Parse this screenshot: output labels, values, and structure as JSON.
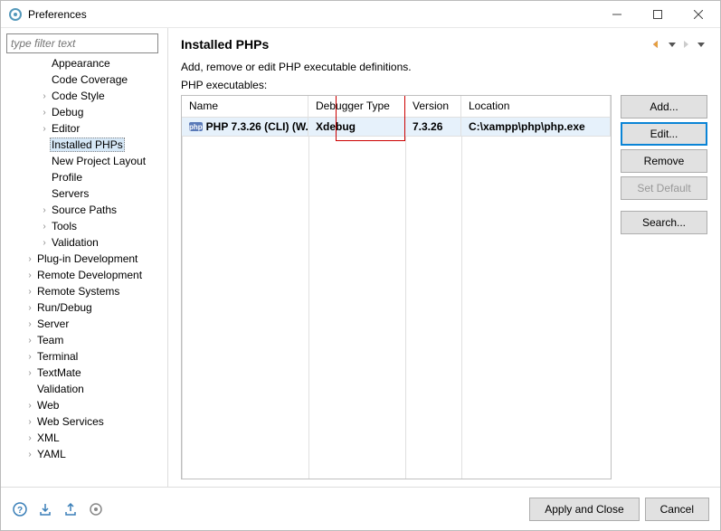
{
  "window": {
    "title": "Preferences"
  },
  "filter_placeholder": "type filter text",
  "tree": [
    {
      "label": "Appearance",
      "depth": 2,
      "arrow": ""
    },
    {
      "label": "Code Coverage",
      "depth": 2,
      "arrow": ""
    },
    {
      "label": "Code Style",
      "depth": 2,
      "arrow": "›"
    },
    {
      "label": "Debug",
      "depth": 2,
      "arrow": "›"
    },
    {
      "label": "Editor",
      "depth": 2,
      "arrow": "›"
    },
    {
      "label": "Installed PHPs",
      "depth": 2,
      "arrow": "",
      "selected": true
    },
    {
      "label": "New Project Layout",
      "depth": 2,
      "arrow": ""
    },
    {
      "label": "Profile",
      "depth": 2,
      "arrow": ""
    },
    {
      "label": "Servers",
      "depth": 2,
      "arrow": ""
    },
    {
      "label": "Source Paths",
      "depth": 2,
      "arrow": "›"
    },
    {
      "label": "Tools",
      "depth": 2,
      "arrow": "›"
    },
    {
      "label": "Validation",
      "depth": 2,
      "arrow": "›"
    },
    {
      "label": "Plug-in Development",
      "depth": 1,
      "arrow": "›"
    },
    {
      "label": "Remote Development",
      "depth": 1,
      "arrow": "›"
    },
    {
      "label": "Remote Systems",
      "depth": 1,
      "arrow": "›"
    },
    {
      "label": "Run/Debug",
      "depth": 1,
      "arrow": "›"
    },
    {
      "label": "Server",
      "depth": 1,
      "arrow": "›"
    },
    {
      "label": "Team",
      "depth": 1,
      "arrow": "›"
    },
    {
      "label": "Terminal",
      "depth": 1,
      "arrow": "›"
    },
    {
      "label": "TextMate",
      "depth": 1,
      "arrow": "›"
    },
    {
      "label": "Validation",
      "depth": 1,
      "arrow": ""
    },
    {
      "label": "Web",
      "depth": 1,
      "arrow": "›"
    },
    {
      "label": "Web Services",
      "depth": 1,
      "arrow": "›"
    },
    {
      "label": "XML",
      "depth": 1,
      "arrow": "›"
    },
    {
      "label": "YAML",
      "depth": 1,
      "arrow": "›"
    }
  ],
  "main": {
    "heading": "Installed PHPs",
    "description": "Add, remove or edit PHP executable definitions.",
    "subdescription": "PHP executables:",
    "columns": {
      "name": "Name",
      "debugger": "Debugger Type",
      "version": "Version",
      "location": "Location"
    },
    "row": {
      "name": "PHP 7.3.26 (CLI) (W...",
      "debugger": "Xdebug",
      "version": "7.3.26",
      "location": "C:\\xampp\\php\\php.exe"
    },
    "buttons": {
      "add": "Add...",
      "edit": "Edit...",
      "remove": "Remove",
      "setdefault": "Set Default",
      "search": "Search..."
    }
  },
  "footer": {
    "apply_close": "Apply and Close",
    "cancel": "Cancel"
  }
}
